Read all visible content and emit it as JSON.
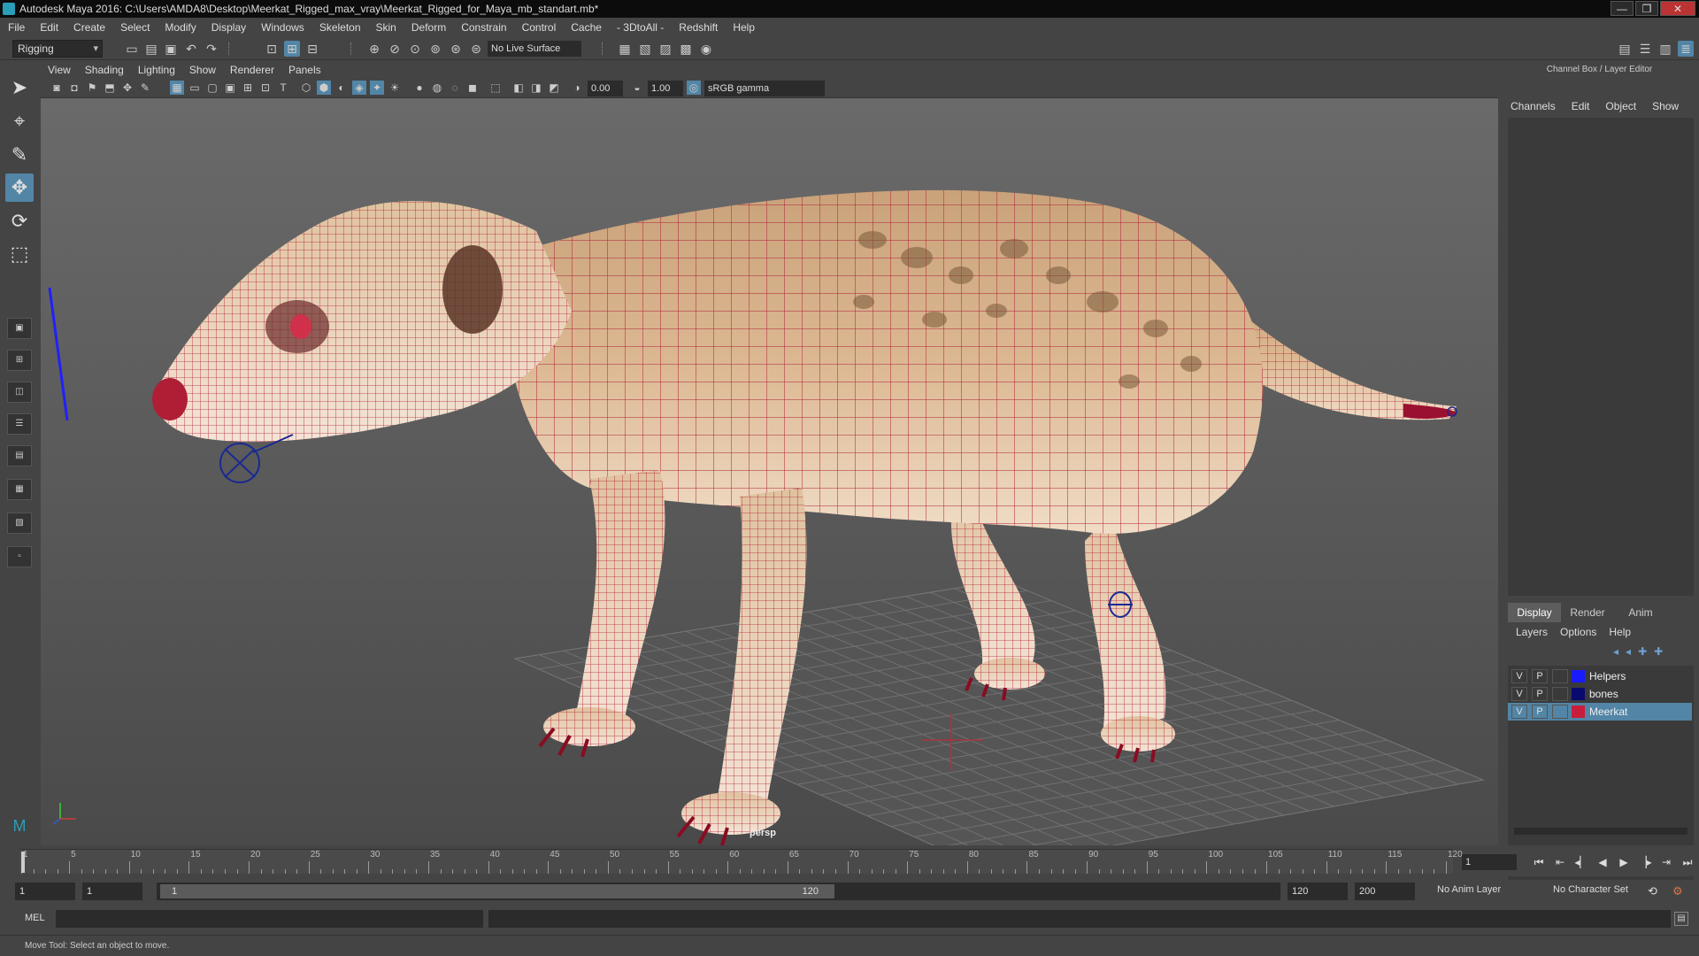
{
  "window": {
    "title": "Autodesk Maya 2016: C:\\Users\\AMDA8\\Desktop\\Meerkat_Rigged_max_vray\\Meerkat_Rigged_for_Maya_mb_standart.mb*",
    "controls": [
      "—",
      "❐",
      "✕"
    ]
  },
  "menubar": [
    "File",
    "Edit",
    "Create",
    "Select",
    "Modify",
    "Display",
    "Windows",
    "Skeleton",
    "Skin",
    "Deform",
    "Constrain",
    "Control",
    "Cache",
    "- 3DtoAll -",
    "Redshift",
    "Help"
  ],
  "statusline": {
    "menu_set": "Rigging",
    "live_surface": "No Live Surface"
  },
  "viewport": {
    "menu": [
      "View",
      "Shading",
      "Lighting",
      "Show",
      "Renderer",
      "Panels"
    ],
    "exposure": "0.00",
    "gamma": "1.00",
    "color_space": "sRGB gamma",
    "camera_label": "persp"
  },
  "channel_box": {
    "title": "Channel Box / Layer Editor",
    "menu": [
      "Channels",
      "Edit",
      "Object",
      "Show"
    ]
  },
  "layer_editor": {
    "tabs": [
      "Display",
      "Render",
      "Anim"
    ],
    "active_tab": "Display",
    "menu": [
      "Layers",
      "Options",
      "Help"
    ],
    "layers": [
      {
        "v": "V",
        "p": "P",
        "name": "Helpers",
        "color": "#1a1aff",
        "selected": false
      },
      {
        "v": "V",
        "p": "P",
        "name": "bones",
        "color": "#0a0a6e",
        "selected": false
      },
      {
        "v": "V",
        "p": "P",
        "name": "Meerkat",
        "color": "#c81e3c",
        "selected": true
      }
    ]
  },
  "timeslider": {
    "tick_labels": [
      "1",
      "5",
      "10",
      "15",
      "20",
      "25",
      "30",
      "35",
      "40",
      "45",
      "50",
      "55",
      "60",
      "65",
      "70",
      "75",
      "80",
      "85",
      "90",
      "95",
      "100",
      "105",
      "110",
      "115",
      "120"
    ],
    "current_frame": "1"
  },
  "rangeslider": {
    "start": "1",
    "playback_start": "1",
    "range_left": "1",
    "range_right": "120",
    "playback_end": "120",
    "end": "200",
    "anim_layer": "No Anim Layer",
    "character_set": "No Character Set"
  },
  "cmdline": {
    "lang": "MEL"
  },
  "helpline": {
    "text": "Move Tool: Select an object to move."
  },
  "colors": {
    "accent": "#5285a6",
    "wireframe": "#b01e35",
    "viewport_bg": "#5d5d5d"
  }
}
